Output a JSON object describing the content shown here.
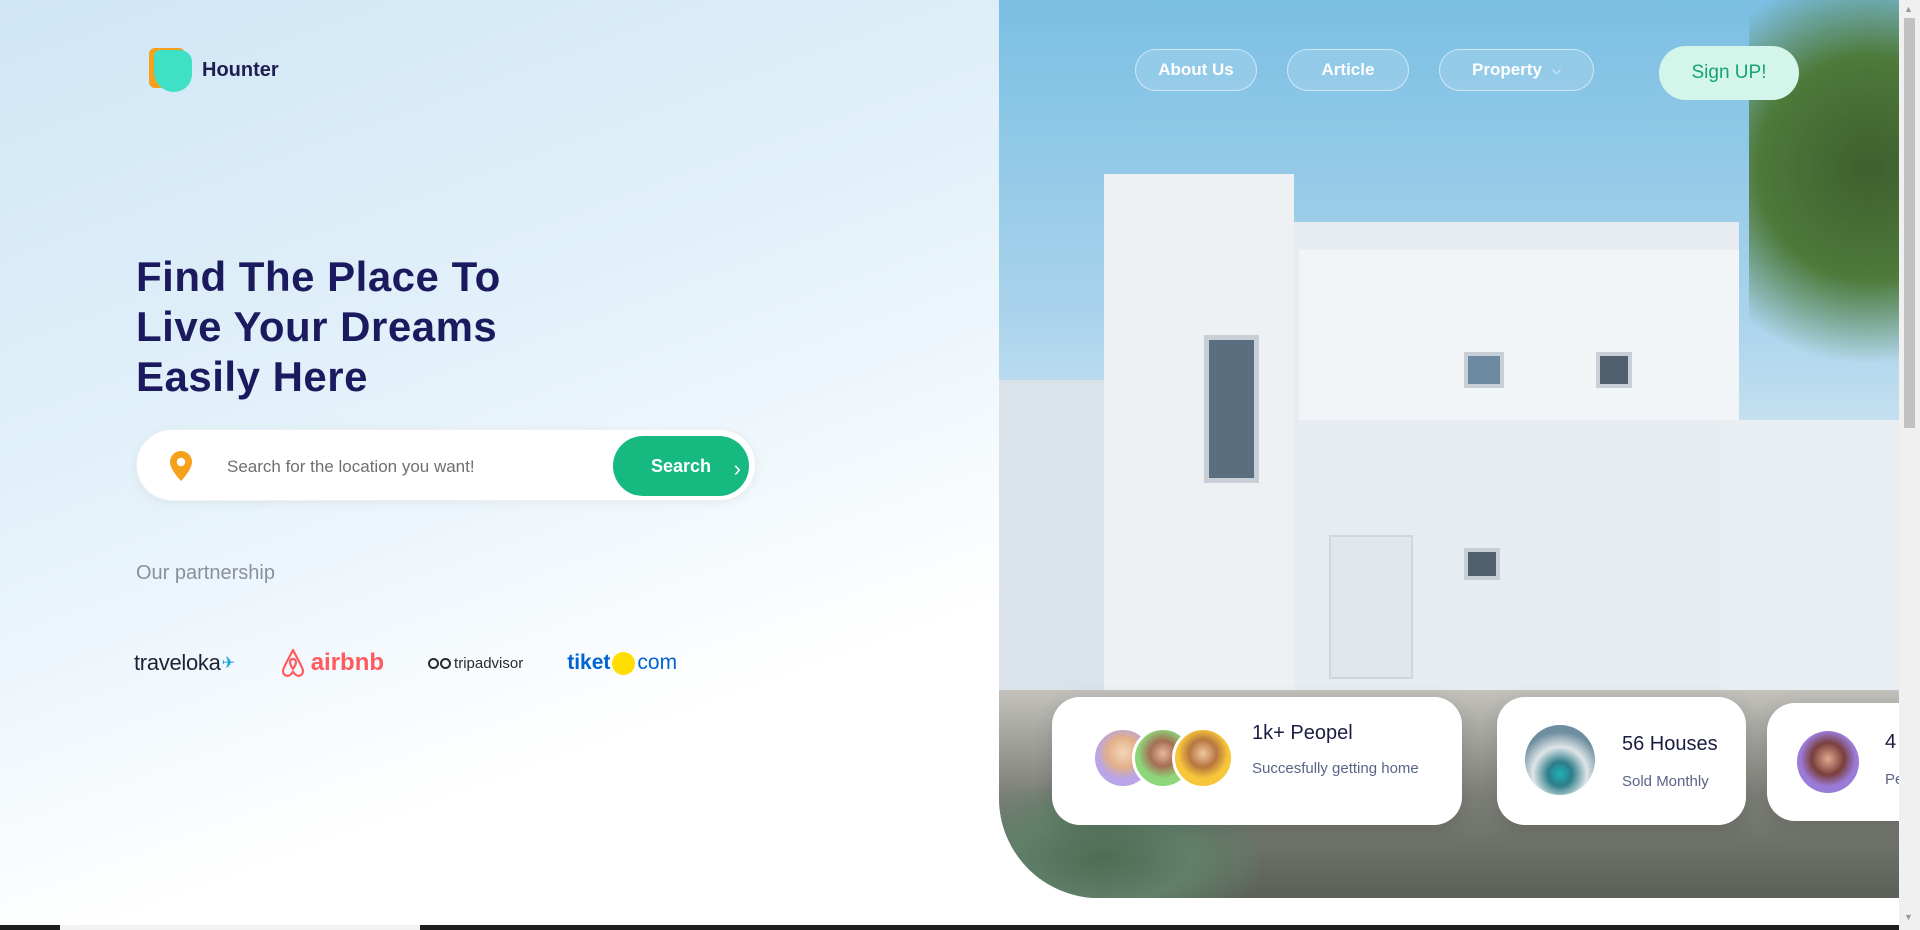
{
  "brand": {
    "name": "Hounter"
  },
  "nav": {
    "about": "About Us",
    "article": "Article",
    "property": "Property",
    "signup": "Sign UP!"
  },
  "hero": {
    "title_lines": [
      "Find The Place To",
      "Live Your Dreams",
      "Easily Here"
    ]
  },
  "search": {
    "placeholder": "Search for the location you want!",
    "button": "Search"
  },
  "partnership": {
    "label": "Our partnership",
    "logos": [
      {
        "name": "traveloka",
        "icon": "traveloka-bird-icon"
      },
      {
        "name": "airbnb",
        "icon": "airbnb-icon"
      },
      {
        "name": "tripadvisor",
        "icon": "tripadvisor-owl-icon"
      },
      {
        "name": "tiket",
        "suffix": "com",
        "icon": "tiket-dot-icon"
      }
    ]
  },
  "stats": [
    {
      "title": "1k+ Peopel",
      "subtitle": "Succesfully getting home"
    },
    {
      "title": "56 Houses",
      "subtitle": "Sold Monthly"
    },
    {
      "title": "4",
      "subtitle": "Pe"
    }
  ],
  "colors": {
    "primary": "#16b97f",
    "heading": "#1c1a5e",
    "signup_bg": "#d4f6ea",
    "logo_orange": "#f5a11c",
    "logo_teal": "#3ee1c6",
    "pin": "#f5a11c"
  }
}
